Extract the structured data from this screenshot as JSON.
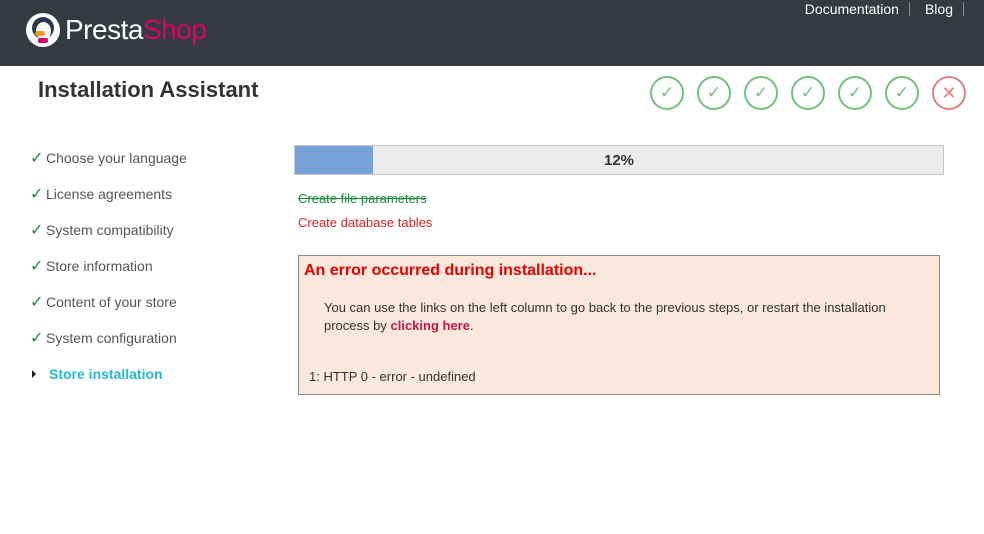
{
  "header": {
    "logo_part1": "Presta",
    "logo_part2": "Shop",
    "links": [
      "Documentation",
      "Blog"
    ]
  },
  "title": "Installation Assistant",
  "step_circles": [
    {
      "status": "done",
      "icon": "✓"
    },
    {
      "status": "done",
      "icon": "✓"
    },
    {
      "status": "done",
      "icon": "✓"
    },
    {
      "status": "done",
      "icon": "✓"
    },
    {
      "status": "done",
      "icon": "✓"
    },
    {
      "status": "done",
      "icon": "✓"
    },
    {
      "status": "error",
      "icon": "✕"
    }
  ],
  "sidebar": {
    "items": [
      {
        "label": "Choose your language",
        "status": "done"
      },
      {
        "label": "License agreements",
        "status": "done"
      },
      {
        "label": "System compatibility",
        "status": "done"
      },
      {
        "label": "Store information",
        "status": "done"
      },
      {
        "label": "Content of your store",
        "status": "done"
      },
      {
        "label": "System configuration",
        "status": "done"
      },
      {
        "label": "Store installation",
        "status": "current"
      }
    ]
  },
  "progress": {
    "value": 0.12,
    "label": "12%"
  },
  "tasks": {
    "done": "Create file parameters",
    "failed": "Create database tables"
  },
  "error": {
    "title": "An error occurred during installation...",
    "message_before": "You can use the links on the left column to go back to the previous steps, or restart the installation process by ",
    "link_text": "clicking here",
    "message_after": ".",
    "detail": "1: HTTP 0 - error - undefined"
  },
  "colors": {
    "topbar": "#363a41",
    "brand_pink": "#df0067",
    "success": "#72c279",
    "error_circle": "#e08282",
    "current_step": "#25b9d7",
    "progress_fill": "#77a3da",
    "error_bg": "#fbe8dc",
    "error_title": "#e60000"
  }
}
